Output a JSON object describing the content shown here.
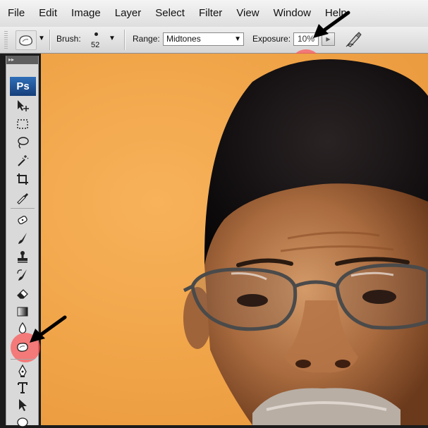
{
  "menu": [
    "File",
    "Edit",
    "Image",
    "Layer",
    "Select",
    "Filter",
    "View",
    "Window",
    "Help"
  ],
  "options": {
    "brush_label": "Brush:",
    "brush_size": "52",
    "range_label": "Range:",
    "range_value": "Midtones",
    "exposure_label": "Exposure:",
    "exposure_value": "10%"
  },
  "toolbox": {
    "logo": "Ps",
    "collapse": "▸▸"
  },
  "colors": {
    "highlight": "#ff5050",
    "ps_blue": "#1f5aa3"
  }
}
